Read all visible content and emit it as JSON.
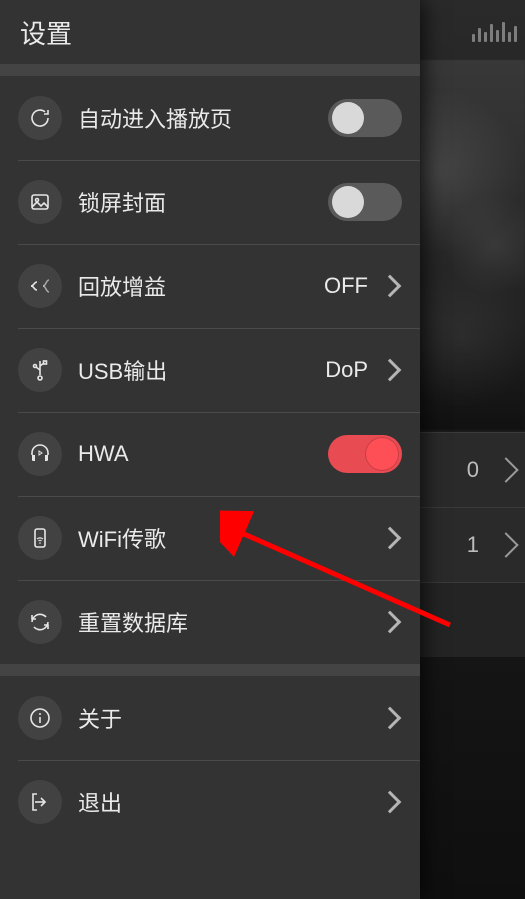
{
  "header": {
    "title": "设置"
  },
  "items": {
    "auto_play": {
      "label": "自动进入播放页",
      "toggle_on": false
    },
    "lock_cover": {
      "label": "锁屏封面",
      "toggle_on": false
    },
    "replay_gain": {
      "label": "回放增益",
      "value": "OFF"
    },
    "usb_out": {
      "label": "USB输出",
      "value": "DoP"
    },
    "hwa": {
      "label": "HWA",
      "toggle_on": true
    },
    "wifi_send": {
      "label": "WiFi传歌"
    },
    "rescan_db": {
      "label": "重置数据库"
    },
    "about": {
      "label": "关于"
    },
    "exit": {
      "label": "退出"
    }
  },
  "background": {
    "row1_value": "0",
    "row2_value": "1"
  },
  "colors": {
    "panel_bg": "#333333",
    "accent": "#e94b52"
  }
}
